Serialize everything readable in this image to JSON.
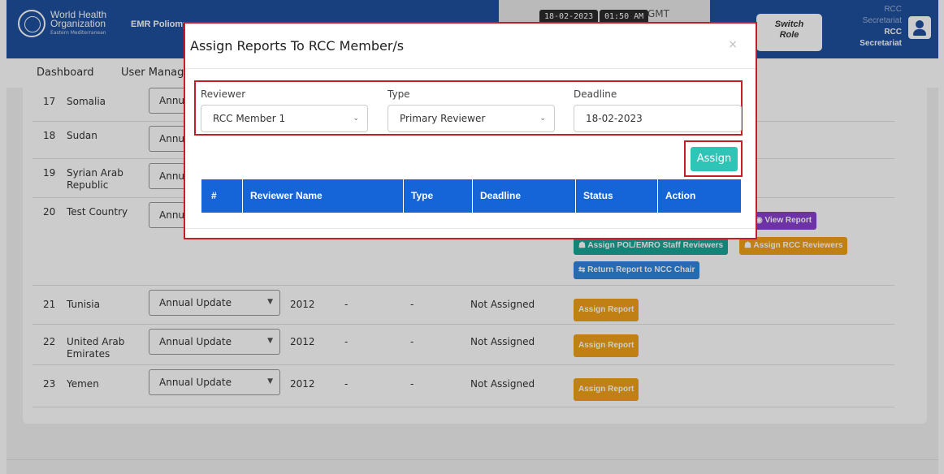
{
  "header": {
    "org_line1": "World Health",
    "org_line2": "Organization",
    "org_line3": "Eastern Mediterranean",
    "app_title": "EMR Poliomy",
    "date": "18-02-2023",
    "time": "01:50 AM",
    "timezone": "GMT",
    "switch_role_line1": "Switch",
    "switch_role_line2": "Role",
    "user_line1": "RCC",
    "user_line2": "Secretariat",
    "user_line3": "RCC",
    "user_line4": "Secretariat"
  },
  "nav": {
    "items": [
      "Dashboard",
      "User Manage"
    ]
  },
  "table": {
    "rows": [
      {
        "num": "17",
        "country": "Somalia",
        "report_type": "Annu"
      },
      {
        "num": "18",
        "country": "Sudan",
        "report_type": "Annu"
      },
      {
        "num": "19",
        "country": "Syrian Arab Republic",
        "report_type": "Annu"
      },
      {
        "num": "20",
        "country": "Test Country",
        "report_type": "Annu"
      },
      {
        "num": "21",
        "country": "Tunisia",
        "report_type": "Annual Update",
        "year": "2012",
        "c1": "-",
        "c2": "-",
        "status": "Not Assigned",
        "action": "Assign Report"
      },
      {
        "num": "22",
        "country": "United Arab Emirates",
        "report_type": "Annual Update",
        "year": "2012",
        "c1": "-",
        "c2": "-",
        "status": "Not Assigned",
        "action": "Assign Report"
      },
      {
        "num": "23",
        "country": "Yemen",
        "report_type": "Annual Update",
        "year": "2012",
        "c1": "-",
        "c2": "-",
        "status": "Not Assigned",
        "action": "Assign Report"
      }
    ],
    "row20_actions": {
      "view_report": "View Report",
      "assign_pol": "Assign POL/EMRO Staff Reviewers",
      "assign_rcc": "Assign RCC Reviewers",
      "return_report": "Return Report to NCC Chair"
    }
  },
  "modal": {
    "title": "Assign Reports To RCC Member/s",
    "close": "×",
    "reviewer_label": "Reviewer",
    "reviewer_value": "RCC Member 1",
    "type_label": "Type",
    "type_value": "Primary Reviewer",
    "deadline_label": "Deadline",
    "deadline_value": "18-02-2023",
    "assign_button": "Assign",
    "columns": [
      "#",
      "Reviewer Name",
      "Type",
      "Deadline",
      "Status",
      "Action"
    ]
  },
  "colors": {
    "header_blue": "#1f4f9e",
    "table_head_blue": "#1565d8",
    "assign_teal": "#2ec4b6",
    "highlight_red": "#c41e2a",
    "btn_orange": "#f0a11a"
  },
  "icons": [
    "who-logo-icon",
    "user-avatar-icon",
    "chevron-down-icon",
    "close-icon",
    "eye-icon",
    "users-icon",
    "return-icon"
  ]
}
